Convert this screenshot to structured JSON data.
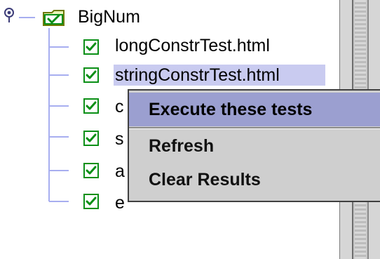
{
  "tree": {
    "root": {
      "label": "BigNum",
      "icon": "checked-folder-icon"
    },
    "items": [
      {
        "label": "longConstrTest.html",
        "checked": true
      },
      {
        "label": "stringConstrTest.html",
        "checked": true,
        "selected": true
      },
      {
        "label": "c",
        "checked": true
      },
      {
        "label": "s",
        "checked": true
      },
      {
        "label": "a",
        "checked": true
      },
      {
        "label": "e",
        "checked": true
      }
    ]
  },
  "context_menu": {
    "items": [
      {
        "label": "Execute these tests",
        "mnemonic": "x",
        "selected": true
      },
      {
        "label": "Refresh",
        "mnemonic": "R"
      },
      {
        "label": "Clear Results",
        "mnemonic": "C"
      }
    ]
  },
  "colors": {
    "selection": "#c9cbf0",
    "menu_highlight": "#9b9fd0",
    "tree_line": "#a7aef0",
    "checkbox_green": "#0a8f16"
  }
}
